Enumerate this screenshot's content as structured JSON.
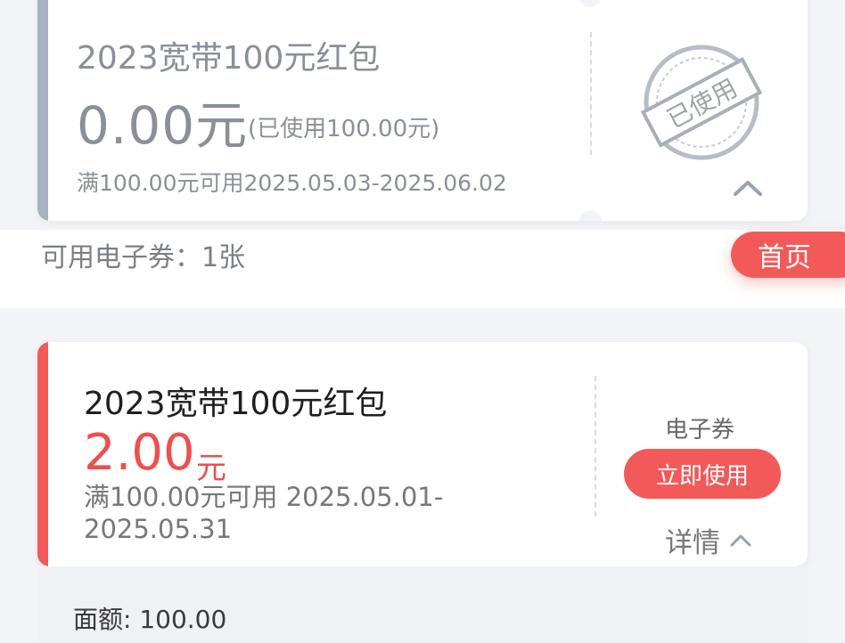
{
  "used_coupon": {
    "title": "2023宽带100元红包",
    "amount": "0.00元",
    "used_detail": "(已使用100.00元)",
    "condition": "满100.00元可用2025.05.03-2025.06.02",
    "stamp_label": "已使用",
    "icons": {
      "collapse": "chevron-up-icon"
    }
  },
  "summary": {
    "available_label": "可用电子券：1张",
    "home_button": "首页"
  },
  "active_coupon": {
    "title": "2023宽带100元红包",
    "amount": "2.00",
    "unit": "元",
    "condition": "满100.00元可用 2025.05.01-2025.05.31",
    "type_label": "电子券",
    "use_button": "立即使用",
    "details_link": "详情",
    "face_value": "面额: 100.00",
    "icons": {
      "details_toggle": "chevron-up-icon"
    }
  },
  "colors": {
    "accent": "#f25a5a",
    "used_stripe": "#a7b1bf",
    "background": "#f3f4f7"
  }
}
